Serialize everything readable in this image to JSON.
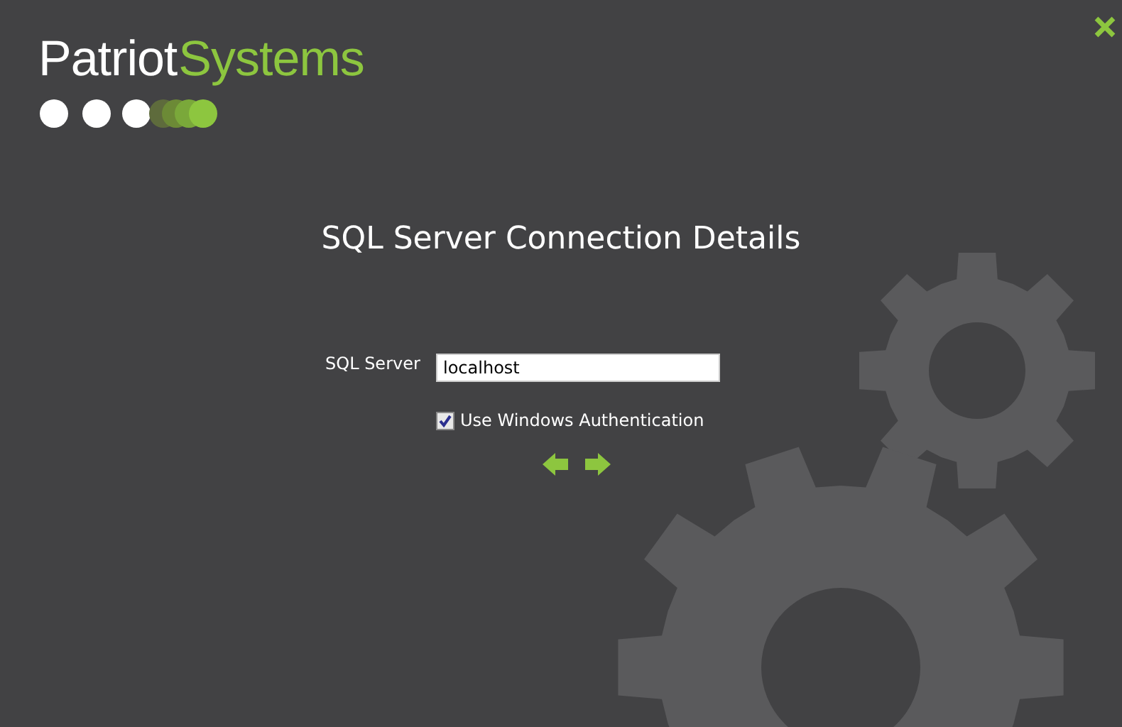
{
  "logo": {
    "primary": "Patriot",
    "secondary": "Systems"
  },
  "title": "SQL Server Connection Details",
  "server_field": {
    "label": "SQL Server",
    "value": "localhost"
  },
  "windows_auth": {
    "label": "Use Windows Authentication",
    "checked": true
  }
}
